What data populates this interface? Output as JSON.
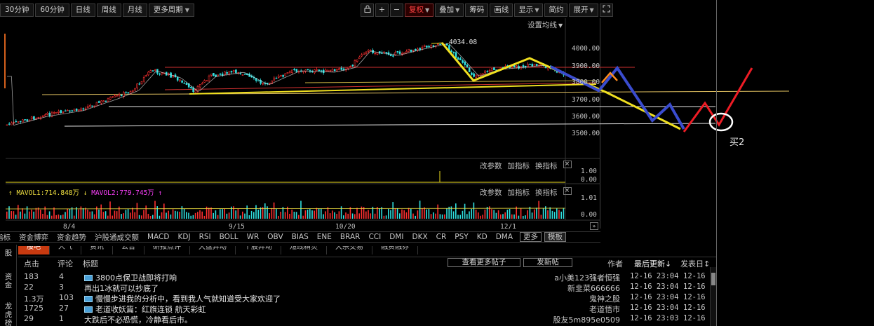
{
  "period_bar": {
    "items": [
      "30分钟",
      "60分钟",
      "日线",
      "周线",
      "月线",
      "更多周期"
    ]
  },
  "toolbar": {
    "lock_icon": "lock-icon",
    "zoom_in": "+",
    "zoom_out": "−",
    "fq_label": "复权",
    "overlay_label": "叠加",
    "chip_label": "筹码",
    "draw_label": "画线",
    "display_label": "显示",
    "simple_label": "简约",
    "expand_label": "展开",
    "fullscreen_icon": "fullscreen-icon"
  },
  "chart": {
    "ma_setting": "设置均线",
    "peak_label": "4034.08",
    "y_ticks": [
      "4000.00",
      "3900.00",
      "3800.00",
      "3700.00",
      "3600.00",
      "3500.00"
    ],
    "ind1_ticks": [
      "1.00",
      "0.00"
    ],
    "vol_ticks": [
      "1.01",
      "0.00"
    ],
    "vol_ma1": "MAVOL1:714.848万",
    "vol_ma2": "MAVOL2:779.745万",
    "dates": [
      "8/4",
      "9/15",
      "10/20",
      "12/1"
    ],
    "ind_actions": [
      "改参数",
      "加指标",
      "换指标"
    ],
    "close_icon": "×",
    "scroll_right": "»",
    "buy_label": "买2",
    "colors": {
      "up": "#ff3030",
      "down": "#30e0e0",
      "yellow": "#f0e020",
      "blue": "#3a4ccf",
      "red": "#ee1c25",
      "white": "#ffffff",
      "orange": "#ff8c20",
      "green": "#30b030"
    }
  },
  "indicator_bar": {
    "items": [
      "指标",
      "资金博弈",
      "资金趋势",
      "沪股通成交额",
      "MACD",
      "KDJ",
      "RSI",
      "BOLL",
      "WR",
      "OBV",
      "BIAS",
      "ENE",
      "BRAR",
      "CCI",
      "DMI",
      "DKX",
      "CR",
      "PSY",
      "KD",
      "DMA"
    ],
    "more": "更多",
    "template": "模板"
  },
  "forum": {
    "side_tabs": [
      "股",
      "资金",
      "龙虎榜"
    ],
    "tabs": [
      "股吧",
      "人气",
      "资讯",
      "公告",
      "研报点评",
      "大盘异动",
      "个股异动",
      "短线精灵",
      "大宗交易",
      "融资融券"
    ],
    "headers": {
      "clicks": "点击",
      "comments": "评论",
      "title": "标题",
      "more_posts": "查看更多帖子",
      "new_post": "发新帖",
      "author": "作者",
      "last_update": "最后更新",
      "post_date": "发表日"
    },
    "rows": [
      {
        "clicks": "183",
        "comments": "4",
        "title": "3800点保卫战即将打响",
        "icon": true,
        "author": "a小美123强者恒强",
        "time": "12-16 23:04",
        "date": "12-16"
      },
      {
        "clicks": "22",
        "comments": "3",
        "title": "再出1冰就可以抄底了",
        "icon": false,
        "author": "新韭菜666666",
        "time": "12-16 23:04",
        "date": "12-16"
      },
      {
        "clicks": "1.3万",
        "comments": "103",
        "title": "慢慢步进我的分析中，看到我人气就知道受大家欢迎了",
        "icon": true,
        "author": "鬼神之股",
        "time": "12-16 23:04",
        "date": "12-16"
      },
      {
        "clicks": "1725",
        "comments": "27",
        "title": "老道收妖篇：红旗连锁 航天彩虹",
        "icon": true,
        "author": "老道悟市",
        "time": "12-16 23:04",
        "date": "12-16"
      },
      {
        "clicks": "29",
        "comments": "1",
        "title": "大跌后不必恐慌，冷静看后市。",
        "icon": false,
        "author": "股友5m895e0509",
        "time": "12-16 23:03",
        "date": "12-16"
      }
    ]
  }
}
